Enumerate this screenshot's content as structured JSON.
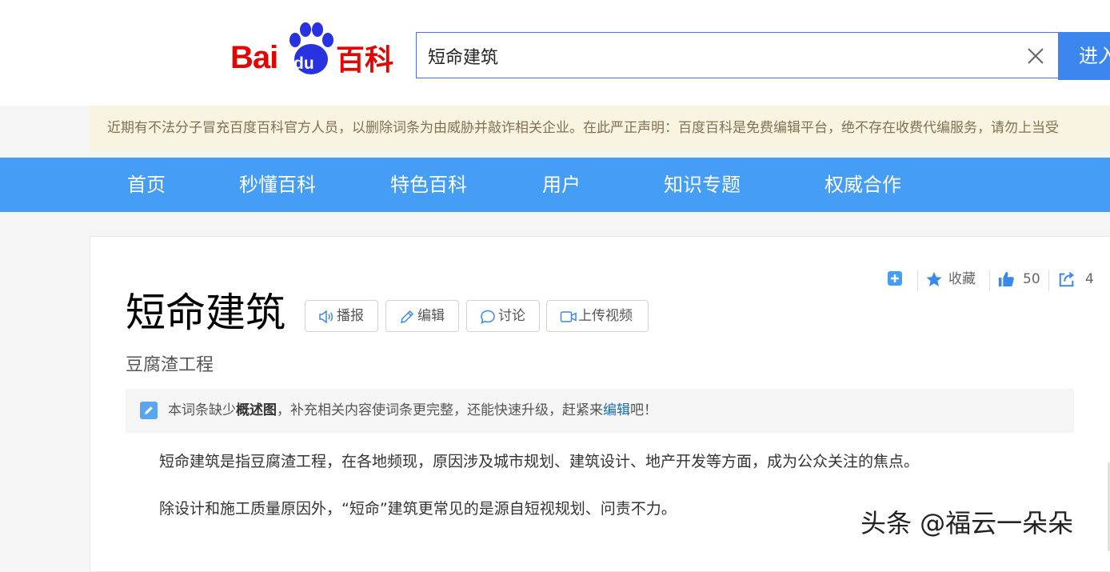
{
  "logo": {
    "bai": "Bai",
    "du": "du",
    "baike": "百科"
  },
  "search": {
    "value": "短命建筑",
    "button": "进入"
  },
  "notice": "近期有不法分子冒充百度百科官方人员，以删除词条为由威胁并敲诈相关企业。在此严正声明：百度百科是免费编辑平台，绝不存在收费代编服务，请勿上当受",
  "nav": [
    "首页",
    "秒懂百科",
    "特色百科",
    "用户",
    "知识专题",
    "权威合作"
  ],
  "entry": {
    "title": "短命建筑",
    "subtitle": "豆腐渣工程",
    "tools": [
      "播报",
      "编辑",
      "讨论",
      "上传视频"
    ]
  },
  "actions": {
    "collect": "收藏",
    "likes": "50",
    "shares": "4"
  },
  "tip": {
    "prefix": "本词条缺少",
    "bold": "概述图",
    "middle": "，补充相关内容使词条更完整，还能快速升级，赶紧来",
    "link": "编辑",
    "suffix": "吧！"
  },
  "paragraphs": [
    "短命建筑是指豆腐渣工程，在各地频现，原因涉及城市规划、建筑设计、地产开发等方面，成为公众关注的焦点。",
    "除设计和施工质量原因外，“短命”建筑更常见的是源自短视规划、问责不力。"
  ],
  "watermark": "头条 @福云一朵朵",
  "colors": {
    "brand_red": "#e10601",
    "paw_blue": "#2932e1",
    "nav_blue": "#459df5",
    "search_blue": "#3b86ef",
    "link_blue": "#136ec2",
    "notice_bg": "#f8f4e1"
  }
}
